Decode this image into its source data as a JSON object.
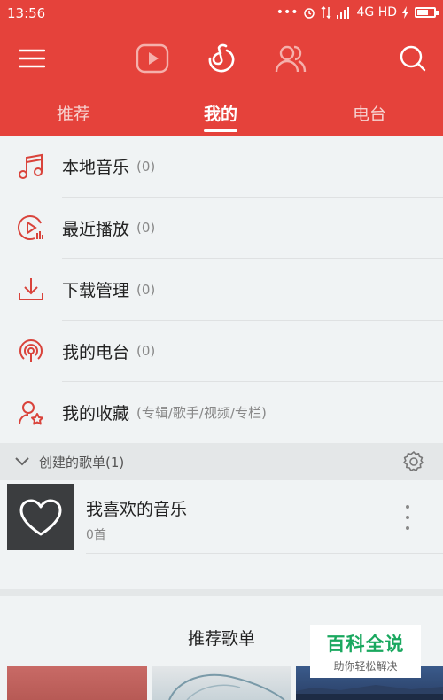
{
  "status_bar": {
    "time": "13:56",
    "dots": "•••",
    "network": "4G HD"
  },
  "tabs": [
    "推荐",
    "我的",
    "电台"
  ],
  "menu": [
    {
      "label": "本地音乐",
      "count": "(0)",
      "icon": "music-note-icon"
    },
    {
      "label": "最近播放",
      "count": "(0)",
      "icon": "recent-play-icon"
    },
    {
      "label": "下载管理",
      "count": "(0)",
      "icon": "download-icon"
    },
    {
      "label": "我的电台",
      "count": "(0)",
      "icon": "radio-icon"
    },
    {
      "label": "我的收藏",
      "count": "(专辑/歌手/视频/专栏)",
      "icon": "user-star-icon"
    }
  ],
  "created_section": {
    "label": "创建的歌单(1)"
  },
  "playlist": {
    "name": "我喜欢的音乐",
    "count": "0首"
  },
  "recommend": {
    "title": "推荐歌单"
  },
  "watermark": {
    "title": "百科全说",
    "subtitle": "助你轻松解决"
  },
  "colors": {
    "header": "#e5423b",
    "accent": "#d9433b",
    "background": "#f0f3f4"
  }
}
